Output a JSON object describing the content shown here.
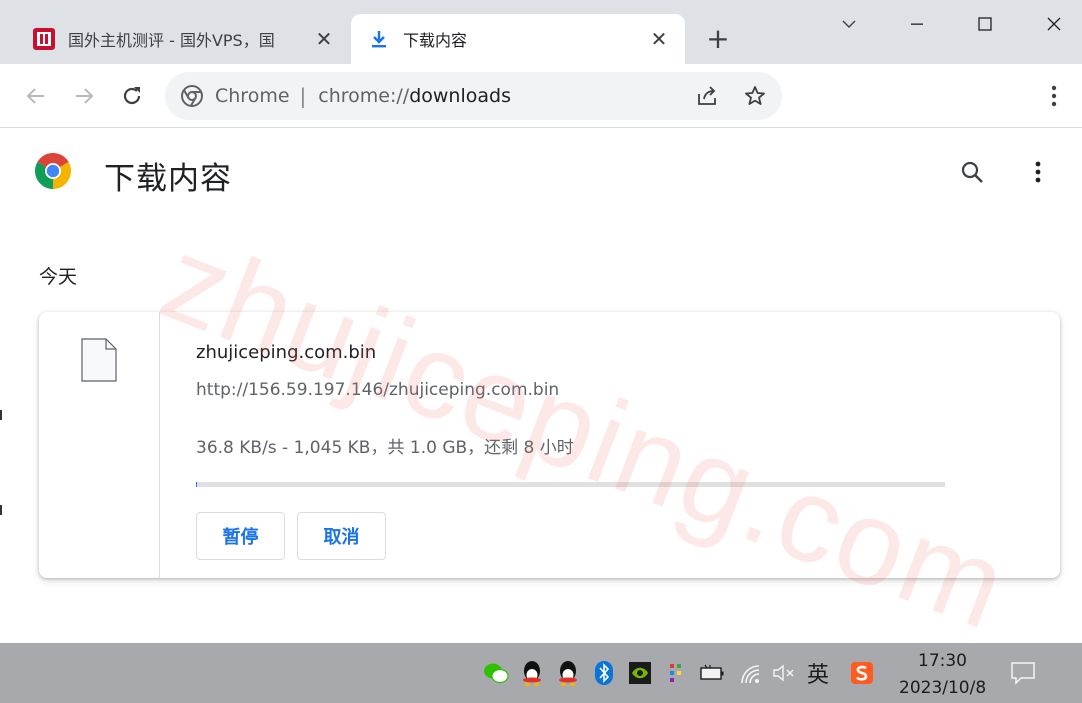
{
  "tabs": [
    {
      "title": "国外主机测评 - 国外VPS，国",
      "close": "✕",
      "active": false
    },
    {
      "title": "下载内容",
      "close": "✕",
      "active": true
    }
  ],
  "newtab_label": "+",
  "omnibox": {
    "chrome_label": "Chrome",
    "separator": "|",
    "url_scheme": "chrome://",
    "url_path": "downloads"
  },
  "page": {
    "title": "下载内容",
    "date_header": "今天",
    "watermark": "zhujiceping.com"
  },
  "download": {
    "file_name": "zhujiceping.com.bin",
    "url": "http://156.59.197.146/zhujiceping.com.bin",
    "progress_text": "36.8 KB/s - 1,045 KB，共 1.0 GB，还剩 8 小时",
    "progress_fraction": 0.001,
    "pause_label": "暂停",
    "cancel_label": "取消"
  },
  "taskbar": {
    "ime_label": "英",
    "time": "17:30",
    "date": "2023/10/8"
  },
  "colors": {
    "accent": "#1a73e8",
    "tabstrip": "#dee1e6",
    "taskbar": "#a7a9ad"
  }
}
